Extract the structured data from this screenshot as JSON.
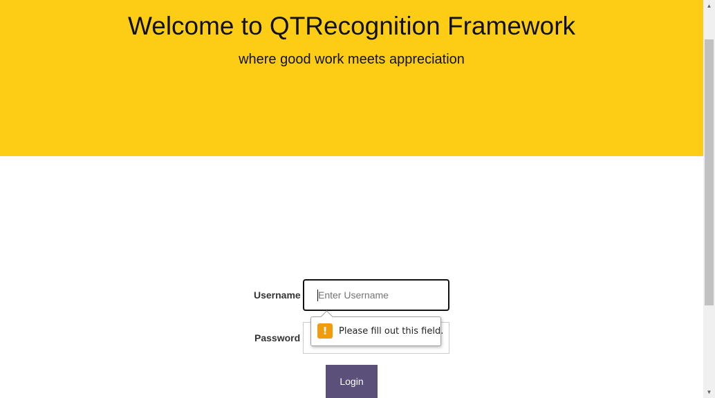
{
  "hero": {
    "title": "Welcome to QTRecognition Framework",
    "subtitle": "where good work meets appreciation",
    "background_color": "#fdcd16"
  },
  "form": {
    "username_label": "Username",
    "username_placeholder": "Enter Username",
    "username_value": "",
    "password_label": "Password",
    "password_value": "",
    "login_label": "Login",
    "login_button_color": "#5a5079"
  },
  "validation_tooltip": {
    "icon": "warning-icon",
    "icon_glyph": "!",
    "icon_color": "#f29c0c",
    "message": "Please fill out this field."
  },
  "scrollbar": {
    "up_icon": "scroll-up-arrow-icon",
    "down_icon": "scroll-down-arrow-icon"
  }
}
